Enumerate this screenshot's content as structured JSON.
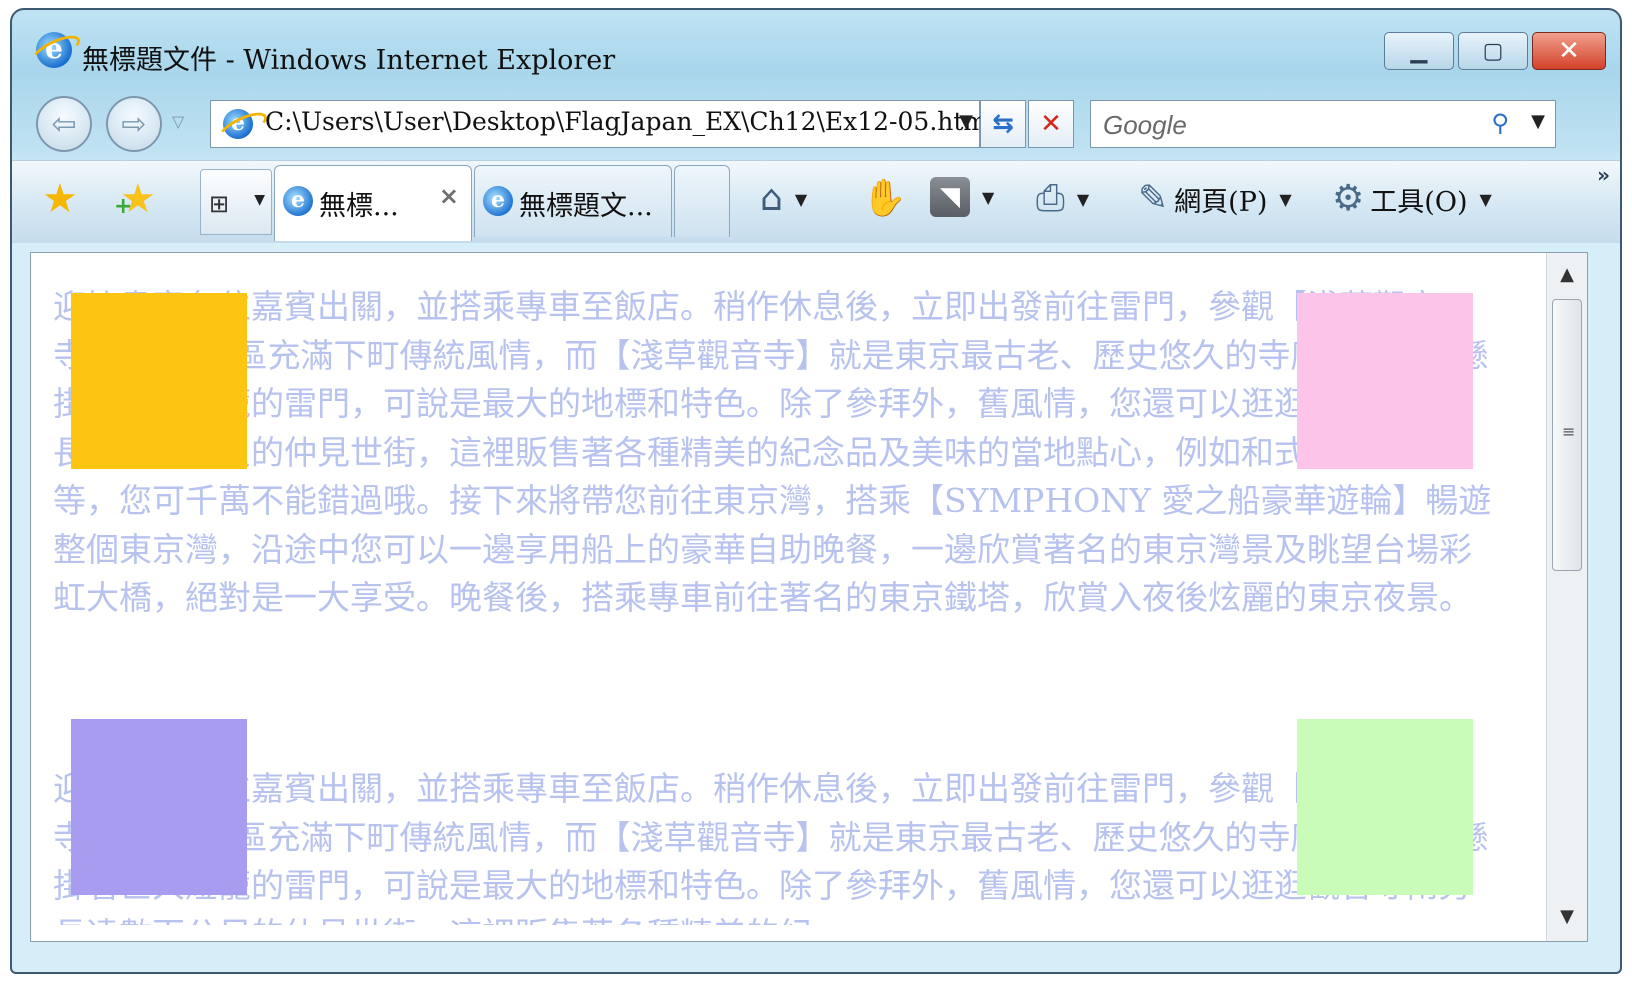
{
  "window": {
    "title": "無標題文件 - Windows Internet Explorer",
    "buttons": {
      "minimize": "▁",
      "maximize": "▢",
      "close": "✕"
    }
  },
  "navigation": {
    "back_icon": "back-arrow-icon",
    "forward_icon": "forward-arrow-icon",
    "address": "C:\\Users\\User\\Desktop\\FlagJapan_EX\\Ch12\\Ex12-05.html",
    "search_placeholder": "Google"
  },
  "tabs": [
    {
      "label": "無標...",
      "active": true,
      "close": "×"
    },
    {
      "label": "無標題文...",
      "active": false
    }
  ],
  "command_bar": {
    "page_menu": "網頁(P)",
    "tools_menu": "工具(O)",
    "more": "»"
  },
  "content": {
    "paragraph_1": "迎接貴賓各位嘉賓出關，並搭乘專車至飯店。稍作休息後，立即出發前往雷門，參觀【淺草觀音寺】。淺草地區充滿下町傳統風情，而【淺草觀音寺】就是東京最古老、歷史悠久的寺廟，入口處懸掛著巨大燈籠的雷門，可說是最大的地標和特色。除了參拜外，舊風情，您還可以逛逛觀音寺兩旁長達數百公尺的仲見世街，這裡販售著各種精美的紀念品及美味的當地點心，例如和式糕點和仙貝等，您可千萬不能錯過哦。接下來將帶您前往東京灣，搭乘【SYMPHONY 愛之船豪華遊輪】暢遊整個東京灣，沿途中您可以一邊享用船上的豪華自助晚餐，一邊欣賞著名的東京灣景及眺望台場彩虹大橋，絕對是一大享受。晚餐後，搭乘專車前往著名的東京鐵塔，欣賞入夜後炫麗的東京夜景。",
    "paragraph_2": "迎接貴賓各位嘉賓出關，並搭乘專車至飯店。稍作休息後，立即出發前往雷門，參觀【淺草觀音寺】。淺草地區充滿下町傳統風情，而【淺草觀音寺】就是東京最古老、歷史悠久的寺廟，入口處懸掛著巨大燈籠的雷門，可說是最大的地標和特色。除了參拜外，舊風情，您還可以逛逛觀音寺兩旁長達數百公尺的仲見世街，這裡販售著各種精美的紀",
    "box_colors": {
      "top_left": "#fcc512",
      "top_right": "#fcc4e8",
      "bottom_left": "#a89cf0",
      "bottom_right": "#c8fcb8"
    }
  }
}
